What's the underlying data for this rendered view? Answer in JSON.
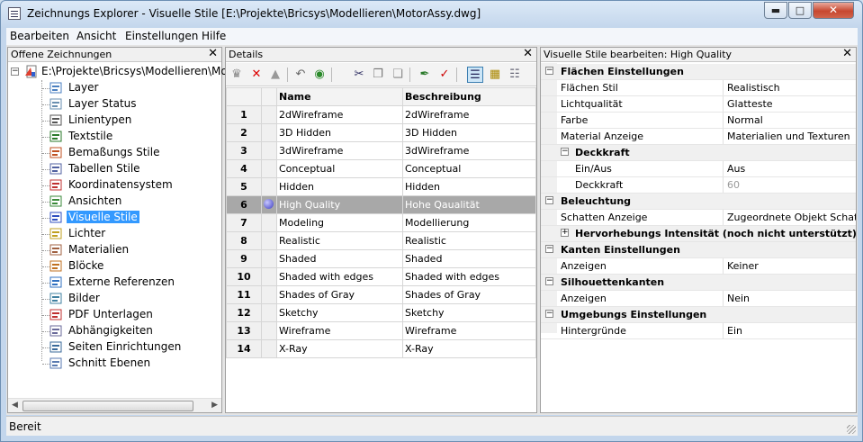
{
  "window": {
    "title": "Zeichnungs Explorer - Visuelle Stile [E:\\Projekte\\Bricsys\\Modellieren\\MotorAssy.dwg]"
  },
  "menu": [
    "Bearbeiten",
    "Ansicht",
    "Einstellungen",
    "Hilfe"
  ],
  "left_pane": {
    "title": "Offene Zeichnungen",
    "root": "E:\\Projekte\\Bricsys\\Modellieren\\Mot",
    "items": [
      "Layer",
      "Layer Status",
      "Linientypen",
      "Textstile",
      "Bemaßungs Stile",
      "Tabellen Stile",
      "Koordinatensystem",
      "Ansichten",
      "Visuelle Stile",
      "Lichter",
      "Materialien",
      "Blöcke",
      "Externe Referenzen",
      "Bilder",
      "PDF Unterlagen",
      "Abhängigkeiten",
      "Seiten Einrichtungen",
      "Schnitt Ebenen"
    ],
    "selected_index": 8
  },
  "details": {
    "title": "Details",
    "headers": {
      "name": "Name",
      "desc": "Beschreibung"
    },
    "rows": [
      {
        "n": "1",
        "name": "2dWireframe",
        "desc": "2dWireframe"
      },
      {
        "n": "2",
        "name": "3D Hidden",
        "desc": "3D Hidden"
      },
      {
        "n": "3",
        "name": "3dWireframe",
        "desc": "3dWireframe"
      },
      {
        "n": "4",
        "name": "Conceptual",
        "desc": "Conceptual"
      },
      {
        "n": "5",
        "name": "Hidden",
        "desc": "Hidden"
      },
      {
        "n": "6",
        "name": "High Quality",
        "desc": "Hohe Qaualität"
      },
      {
        "n": "7",
        "name": "Modeling",
        "desc": "Modellierung"
      },
      {
        "n": "8",
        "name": "Realistic",
        "desc": "Realistic"
      },
      {
        "n": "9",
        "name": "Shaded",
        "desc": "Shaded"
      },
      {
        "n": "10",
        "name": "Shaded with edges",
        "desc": "Shaded with edges"
      },
      {
        "n": "11",
        "name": "Shades of Gray",
        "desc": "Shades of Gray"
      },
      {
        "n": "12",
        "name": "Sketchy",
        "desc": "Sketchy"
      },
      {
        "n": "13",
        "name": "Wireframe",
        "desc": "Wireframe"
      },
      {
        "n": "14",
        "name": "X-Ray",
        "desc": "X-Ray"
      }
    ]
  },
  "props": {
    "title": "Visuelle Stile bearbeiten: High Quality",
    "flaechen": {
      "cat": "Flächen Einstellungen",
      "stil_k": "Flächen Stil",
      "stil_v": "Realistisch",
      "licht_k": "Lichtqualität",
      "licht_v": "Glatteste",
      "farbe_k": "Farbe",
      "farbe_v": "Normal",
      "mat_k": "Material Anzeige",
      "mat_v": "Materialien und Texturen"
    },
    "deckkraft": {
      "cat": "Deckkraft",
      "ein_k": "Ein/Aus",
      "ein_v": "Aus",
      "dk_k": "Deckkraft",
      "dk_v": "60"
    },
    "beleuchtung": {
      "cat": "Beleuchtung",
      "sch_k": "Schatten Anzeige",
      "sch_v": "Zugeordnete Objekt Schatten",
      "hervor": "Hervorhebungs Intensität (noch nicht unterstützt)"
    },
    "kanten": {
      "cat": "Kanten Einstellungen",
      "anz_k": "Anzeigen",
      "anz_v": "Keiner"
    },
    "silh": {
      "cat": "Silhouettenkanten",
      "anz_k": "Anzeigen",
      "anz_v": "Nein"
    },
    "umg": {
      "cat": "Umgebungs Einstellungen",
      "hg_k": "Hintergründe",
      "hg_v": "Ein"
    }
  },
  "status": "Bereit"
}
